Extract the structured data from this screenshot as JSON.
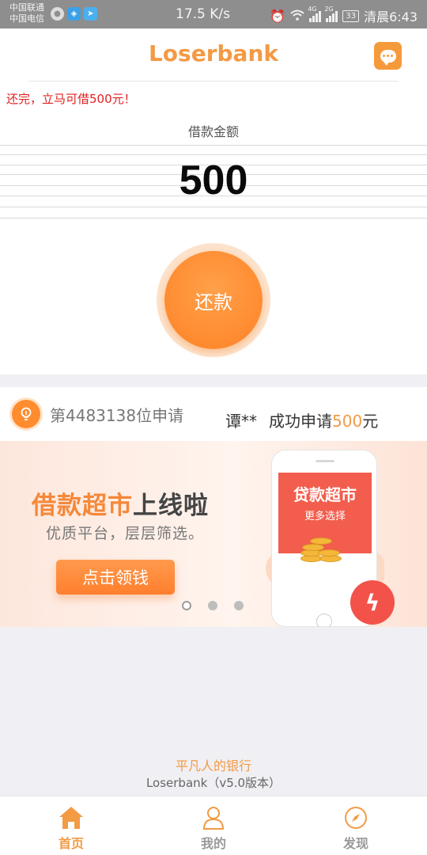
{
  "status_bar": {
    "carrier1": "中国联通",
    "carrier2": "中国电信",
    "speed": "17.5 K/s",
    "sig1_tag": "4G",
    "sig2_tag": "2G",
    "battery": "33",
    "time": "清晨6:43",
    "icons": [
      "message-icon",
      "shield-app-icon",
      "plane-app-icon",
      "alarm-icon",
      "wifi-icon",
      "signal-icon",
      "battery-icon"
    ]
  },
  "header": {
    "title": "Loserbank",
    "chat_icon": "chat-bubble-icon"
  },
  "loan": {
    "notice": "还完，立马可借500元！",
    "amount_label": "借款金额",
    "amount": "500",
    "repay_label": "还款"
  },
  "applicant": {
    "number_text": "第4483138位申请",
    "name": "谭**",
    "success_prefix": "成功申请",
    "success_amount": "500",
    "success_suffix": "元"
  },
  "banner": {
    "title_highlight": "借款超市",
    "title_rest": "上线啦",
    "subtitle": "优质平台，层层筛选。",
    "cta": "点击领钱",
    "phone_title": "贷款超市",
    "phone_more": "更多选择",
    "slide_count": 3,
    "active_slide": 1
  },
  "footer": {
    "tagline": "平凡人的银行",
    "version": "Loserbank（v5.0版本）"
  },
  "tabs": [
    {
      "label": "首页",
      "icon": "home-icon",
      "active": true
    },
    {
      "label": "我的",
      "icon": "user-icon",
      "active": false
    },
    {
      "label": "发现",
      "icon": "compass-icon",
      "active": false
    }
  ],
  "colors": {
    "accent": "#f39a45",
    "notice_red": "#e02020",
    "button_orange": "#ff8a2d"
  }
}
